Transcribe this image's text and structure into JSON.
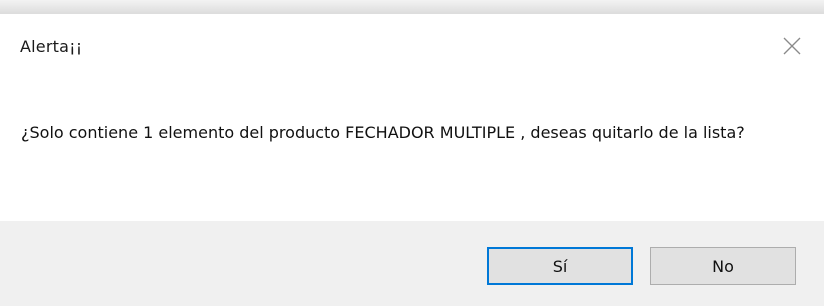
{
  "dialog": {
    "title": "Alerta¡¡",
    "message": "¿Solo contiene 1 elemento del producto FECHADOR  MULTIPLE , deseas quitarlo de la lista?",
    "close_icon": "close-icon"
  },
  "buttons": {
    "yes_label": "Sí",
    "no_label": "No"
  },
  "colors": {
    "accent": "#0078d7",
    "footer_bg": "#f0f0f0",
    "button_bg": "#e1e1e1"
  }
}
